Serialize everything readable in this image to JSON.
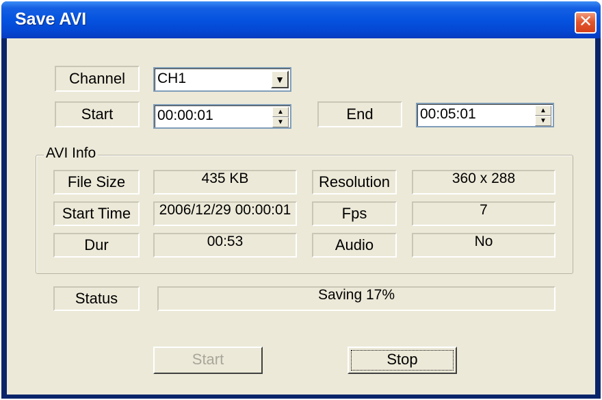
{
  "window": {
    "title": "Save AVI",
    "close_symbol": "✕"
  },
  "channel": {
    "label": "Channel",
    "value": "CH1",
    "dropdown_symbol": "▼"
  },
  "start": {
    "label": "Start",
    "value": "00:00:01"
  },
  "end": {
    "label": "End",
    "value": "00:05:01"
  },
  "spin_symbols": {
    "up": "▲",
    "down": "▼"
  },
  "avi_info": {
    "title": "AVI Info",
    "file_size": {
      "label": "File Size",
      "value": "435 KB"
    },
    "start_time": {
      "label": "Start Time",
      "value": "2006/12/29 00:00:01"
    },
    "dur": {
      "label": "Dur",
      "value": "00:53"
    },
    "resolution": {
      "label": "Resolution",
      "value": "360 x 288"
    },
    "fps": {
      "label": "Fps",
      "value": "7"
    },
    "audio": {
      "label": "Audio",
      "value": "No"
    }
  },
  "status": {
    "label": "Status",
    "value": "Saving 17%"
  },
  "buttons": {
    "start": "Start",
    "stop": "Stop"
  },
  "colors": {
    "title_bar": "#0553df",
    "close_button": "#d5411b",
    "face": "#ece9d8"
  }
}
